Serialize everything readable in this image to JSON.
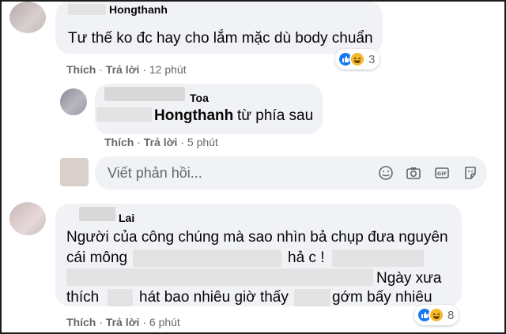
{
  "comments": [
    {
      "author": "Hongthanh",
      "text": "Tư thế ko đc hay cho lắm mặc dù body chuẩn",
      "actions": {
        "like": "Thích",
        "reply": "Trả lời",
        "time": "12 phút"
      },
      "reactions": {
        "types": [
          "like-icon",
          "haha-icon"
        ],
        "count": "3"
      }
    },
    {
      "author": "Toa",
      "mention": "Hongthanh",
      "text": "từ phía sau",
      "actions": {
        "like": "Thích",
        "reply": "Trả lời",
        "time": "5 phút"
      }
    },
    {
      "author": "Lai",
      "line1": "Người của công chúng mà sao nhìn bả chụp đưa nguyên",
      "line2_start": "cái mông",
      "line2_end": "hả c !",
      "line3_end": "Ngày xưa",
      "line4_start": "thích",
      "line4_mid": "hát bao nhiêu giờ thấy",
      "line4_end": "gớm bấy nhiêu",
      "actions": {
        "like": "Thích",
        "reply": "Trả lời",
        "time": "6 phút"
      },
      "reactions": {
        "types": [
          "like-icon",
          "haha-icon"
        ],
        "count": "8"
      }
    }
  ],
  "reply_input": {
    "placeholder": "Viết phản hồi...",
    "tools": [
      "emoji-icon",
      "camera-icon",
      "gif-icon",
      "sticker-icon"
    ]
  },
  "colors": {
    "bubble": "#f0f2f5",
    "like_blue": "#1877f2",
    "haha_yellow": "#f7b928",
    "secondary_text": "#65676b"
  }
}
